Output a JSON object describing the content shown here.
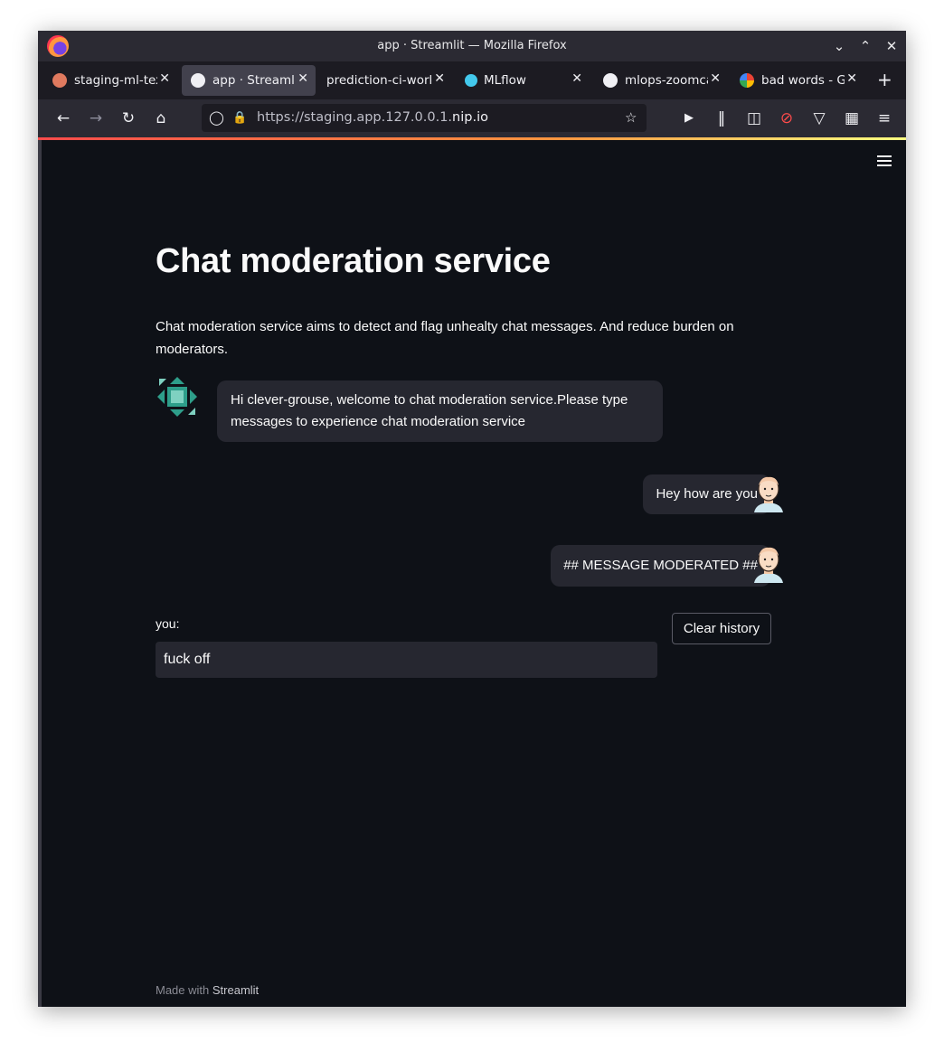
{
  "window": {
    "title": "app · Streamlit — Mozilla Firefox"
  },
  "tabs": [
    {
      "label": "staging-ml-text",
      "icon": "ml-app-icon",
      "active": false
    },
    {
      "label": "app · Streamlit",
      "icon": "streamlit-icon",
      "active": true
    },
    {
      "label": "prediction-ci-workflow",
      "icon": "",
      "active": false
    },
    {
      "label": "MLflow",
      "icon": "mlflow-icon",
      "active": false
    },
    {
      "label": "mlops-zoomcamp",
      "icon": "github-icon",
      "active": false
    },
    {
      "label": "bad words - Google",
      "icon": "google-icon",
      "active": false
    }
  ],
  "nav": {
    "url_prefix": "https://staging.app.127.0.0.1.",
    "url_domain": "nip.io"
  },
  "page": {
    "title": "Chat moderation service",
    "description": "Chat moderation service aims to detect and flag unhealty chat messages. And reduce burden on moderators.",
    "messages": [
      {
        "sender": "bot",
        "text": "Hi clever-grouse, welcome to chat moderation service.Please type messages to experience chat moderation service"
      },
      {
        "sender": "user",
        "text": "Hey how are you"
      },
      {
        "sender": "user",
        "text": "## MESSAGE MODERATED ##"
      }
    ],
    "input_label": "you:",
    "input_value": "fuck off",
    "clear_button": "Clear history",
    "footer_prefix": "Made with",
    "footer_brand": "Streamlit"
  },
  "colors": {
    "background": "#0e1117",
    "bubble": "#262730",
    "bot_avatar": "#2e9e8a"
  }
}
